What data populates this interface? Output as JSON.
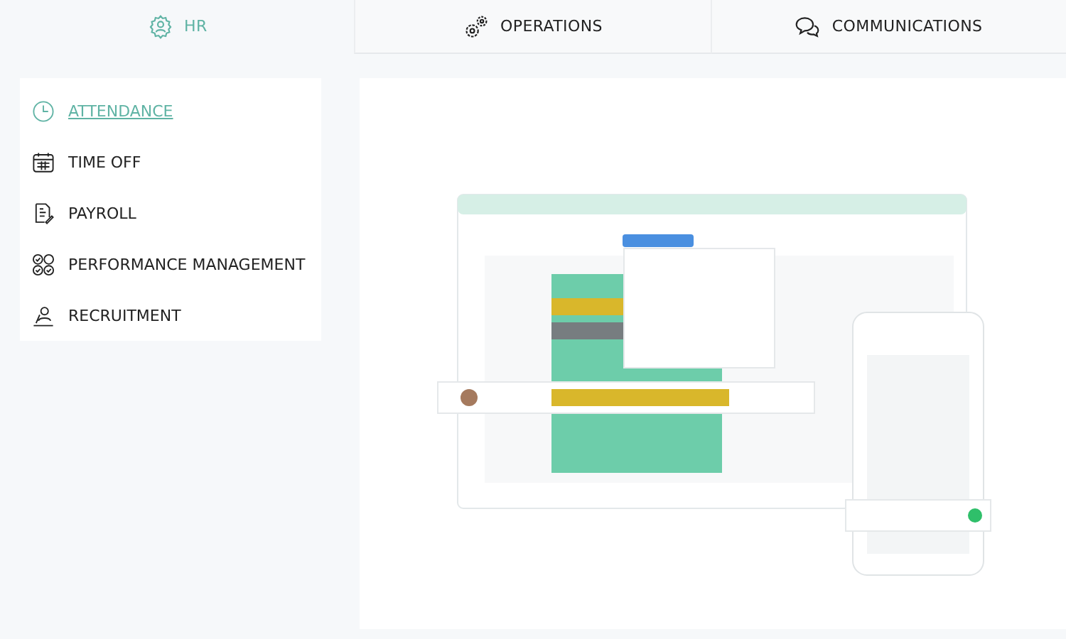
{
  "tabs": [
    {
      "label": "HR",
      "selected": true
    },
    {
      "label": "OPERATIONS",
      "selected": false
    },
    {
      "label": "COMMUNICATIONS",
      "selected": false
    }
  ],
  "sidebar": {
    "items": [
      {
        "label": "ATTENDANCE",
        "selected": true
      },
      {
        "label": "TIME OFF",
        "selected": false
      },
      {
        "label": "PAYROLL",
        "selected": false
      },
      {
        "label": "PERFORMANCE MANAGEMENT",
        "selected": false
      },
      {
        "label": "RECRUITMENT",
        "selected": false
      }
    ]
  }
}
